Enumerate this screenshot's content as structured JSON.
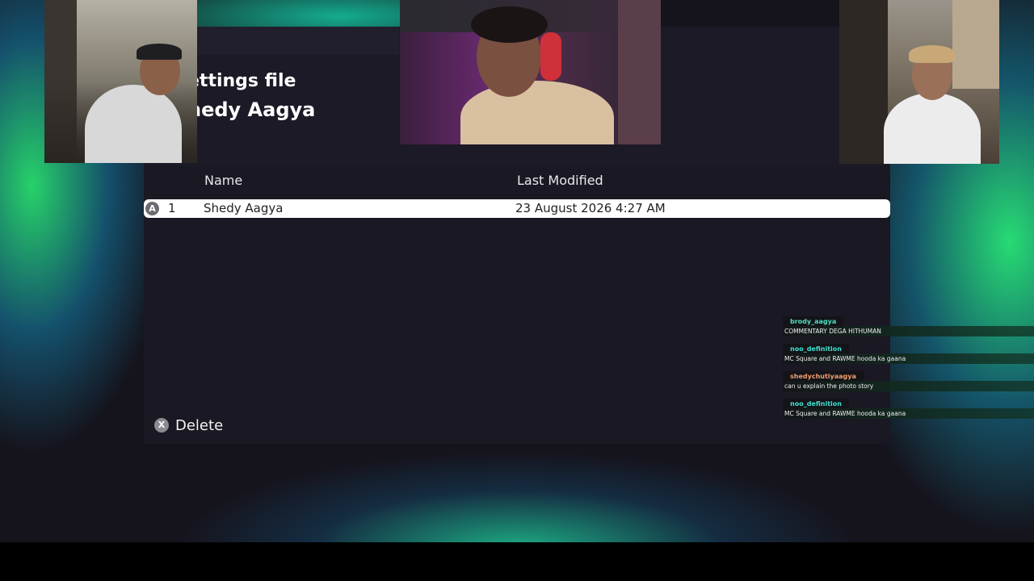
{
  "dialog": {
    "title_line1": "ettings file",
    "title_line2": "hedy Aagya",
    "columns": {
      "name": "Name",
      "last_modified": "Last Modified"
    },
    "rows": [
      {
        "button_glyph": "A",
        "index": "1",
        "name": "Shedy Aagya",
        "last_modified": "23 August 2026 4:27 AM"
      }
    ],
    "delete": {
      "button_glyph": "X",
      "label": "Delete"
    }
  },
  "chat": {
    "messages": [
      {
        "user": "brody_aagya",
        "user_color": "#4de0c0",
        "text": "COMMENTARY DEGA HITHUMAN"
      },
      {
        "user": "noo_definition",
        "user_color": "#3ee0d0",
        "text": "MC Square and RAWME hooda ka gaana"
      },
      {
        "user": "shedychutiyaagya",
        "user_color": "#f0a070",
        "text": "can u explain the photo story"
      },
      {
        "user": "noo_definition",
        "user_color": "#3ee0d0",
        "text": "MC Square and RAWME hooda ka gaana"
      }
    ]
  },
  "colors": {
    "panel": "#1a1822",
    "selected_row": "#ffffff",
    "accent_green": "#2fe07a"
  }
}
